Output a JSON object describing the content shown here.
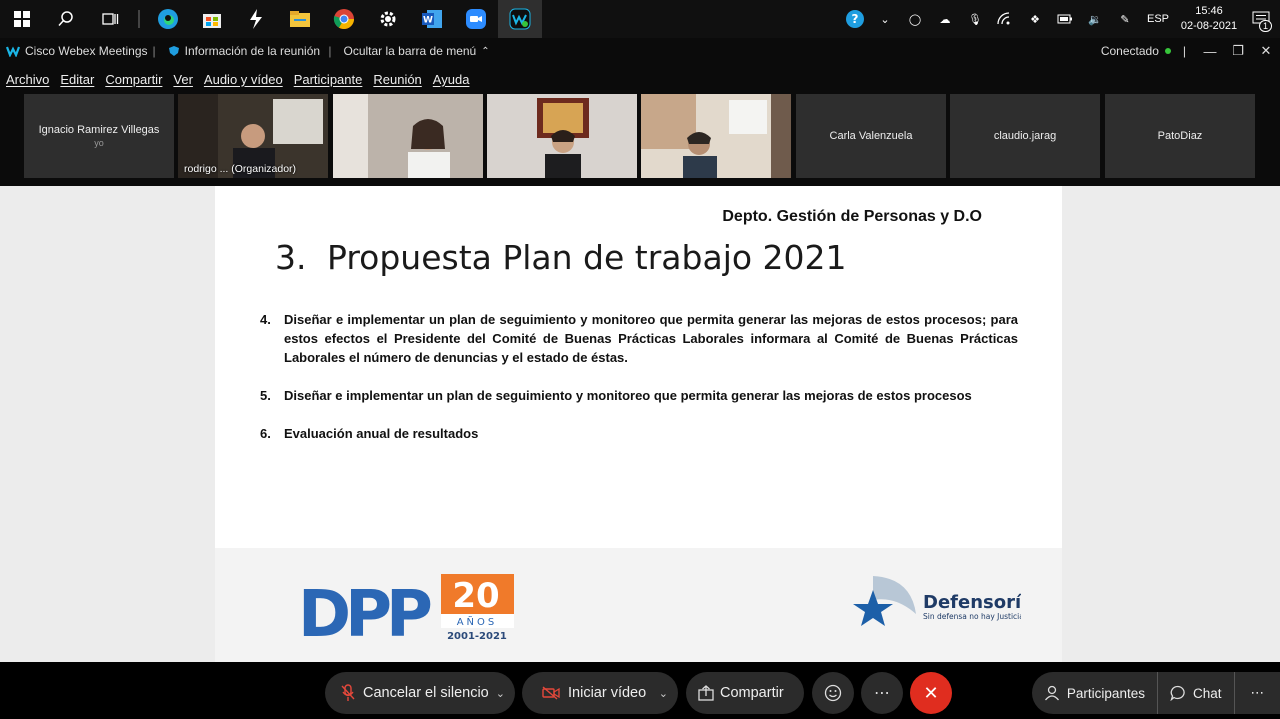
{
  "taskbar": {
    "icons": [
      "windows-start-icon",
      "search-icon",
      "task-view-icon",
      "edge-icon",
      "store-icon",
      "app-icon",
      "file-explorer-icon",
      "chrome-icon",
      "settings-icon",
      "word-icon",
      "zoom-icon",
      "webex-icon"
    ],
    "tray": {
      "language": "ESP",
      "time": "15:46",
      "date": "02-08-2021",
      "notifications": "1"
    }
  },
  "titlebar": {
    "app_name": "Cisco Webex Meetings",
    "meeting_info": "Información de la reunión",
    "hide_menu": "Ocultar la barra de menú",
    "status": "Conectado"
  },
  "menu": {
    "items": [
      "Archivo",
      "Editar",
      "Compartir",
      "Ver",
      "Audio y vídeo",
      "Participante",
      "Reunión",
      "Ayuda"
    ]
  },
  "participants": [
    {
      "name": "Ignacio Ramirez Villegas",
      "sub": "yo",
      "video": false
    },
    {
      "name": "rodrigo ...  (Organizador)",
      "video": true,
      "active": true
    },
    {
      "name": "",
      "video": true
    },
    {
      "name": "",
      "video": true
    },
    {
      "name": "",
      "video": true
    },
    {
      "name": "Carla Valenzuela",
      "video": false
    },
    {
      "name": "claudio.jarag",
      "video": false
    },
    {
      "name": "PatoDiaz",
      "video": false
    }
  ],
  "slide": {
    "dept": "Depto. Gestión de Personas y D.O",
    "title_num": "3.",
    "title": "Propuesta Plan de trabajo 2021",
    "items": [
      {
        "n": "4.",
        "text": "Diseñar e implementar un plan de seguimiento y monitoreo que permita generar las mejoras de estos procesos; para estos efectos el Presidente del Comité de Buenas Prácticas Laborales informara al Comité de Buenas Prácticas Laborales el número de denuncias y el estado de éstas."
      },
      {
        "n": "5.",
        "text": "Diseñar e implementar un plan de seguimiento y monitoreo que permita generar las mejoras de estos procesos"
      },
      {
        "n": "6.",
        "text": "Evaluación anual de resultados"
      }
    ],
    "logo_left": {
      "text": "DPP",
      "anos": "AÑOS",
      "years": "2001-2021",
      "num": "20"
    },
    "logo_right": {
      "name": "Defensoría",
      "tagline": "Sin defensa no hay Justicia"
    }
  },
  "controls": {
    "unmute": "Cancelar el silencio",
    "start_video": "Iniciar vídeo",
    "share": "Compartir",
    "participants": "Participantes",
    "chat": "Chat"
  },
  "colors": {
    "accent": "#1bb6e6",
    "end_call": "#e02d1f",
    "connected": "#37c63b"
  }
}
